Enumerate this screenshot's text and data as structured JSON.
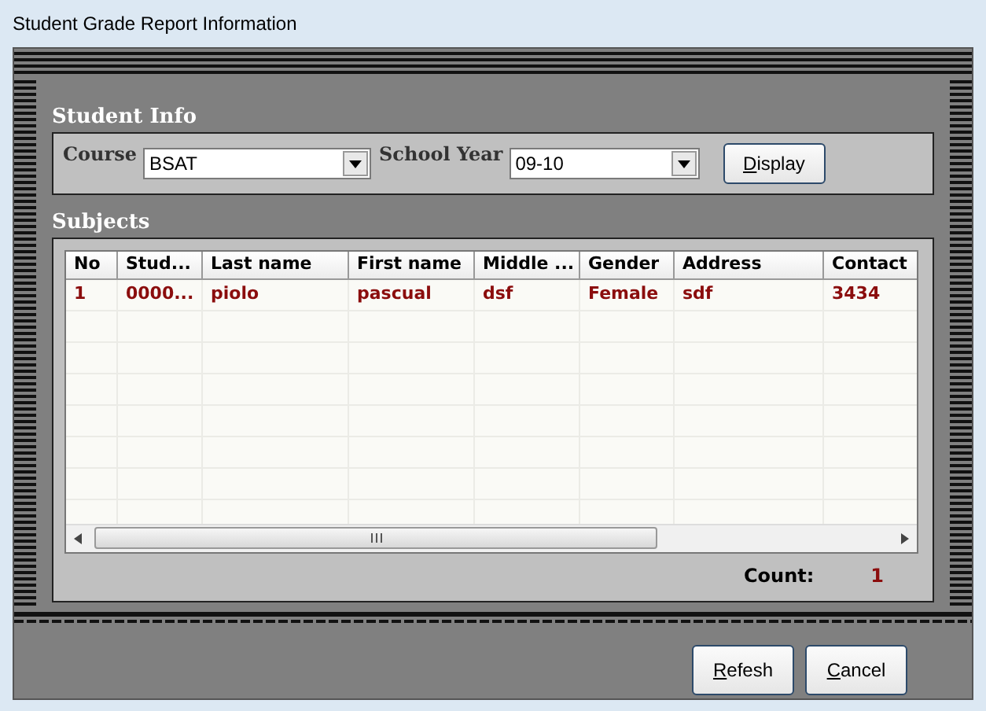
{
  "window": {
    "title": "Student Grade Report Information"
  },
  "student_info": {
    "title": "Student Info",
    "course_label": "Course",
    "course_value": "BSAT",
    "year_label": "School Year",
    "year_value": "09-10",
    "display_button": "Display"
  },
  "subjects": {
    "title": "Subjects",
    "columns": [
      "No",
      "Stud...",
      "Last name",
      "First name",
      "Middle ...",
      "Gender",
      "Address",
      "Contact"
    ],
    "rows": [
      [
        "1",
        "0000...",
        "piolo",
        "pascual",
        "dsf",
        "Female",
        "sdf",
        "3434"
      ]
    ],
    "count_label": "Count:",
    "count_value": "1"
  },
  "buttons": [
    "Refesh",
    "Cancel"
  ]
}
